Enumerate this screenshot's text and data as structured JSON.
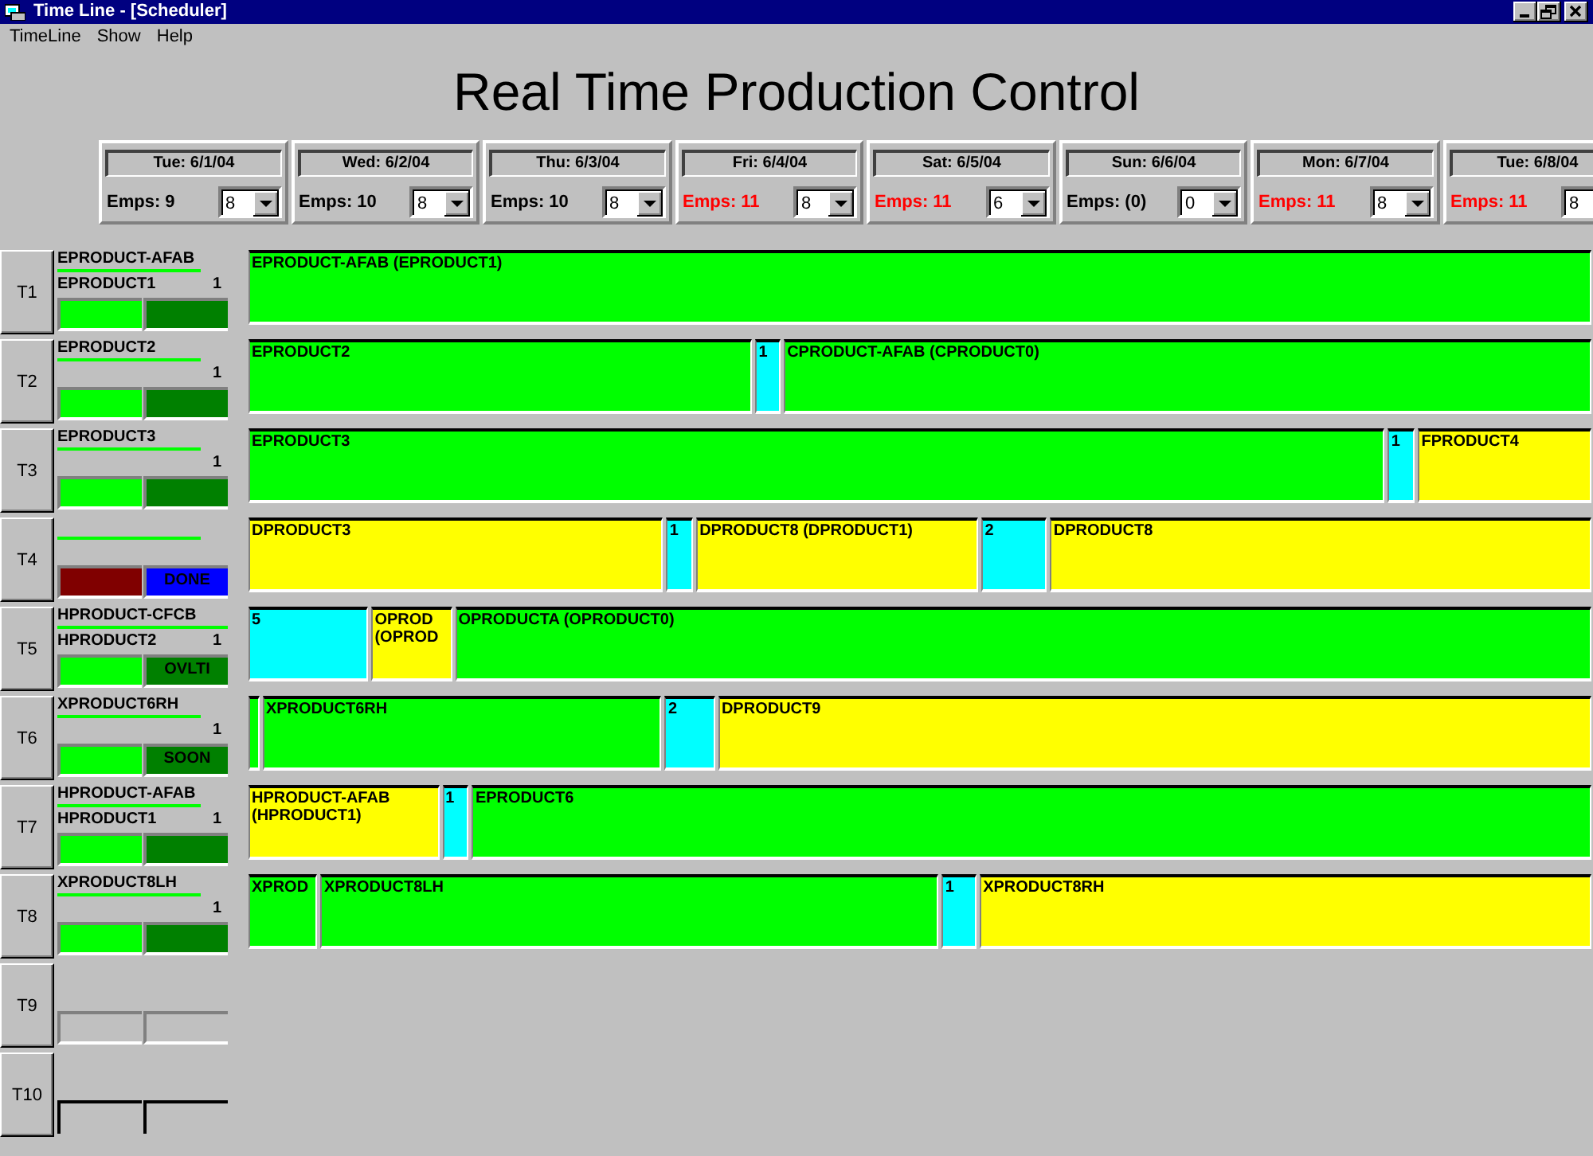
{
  "window": {
    "title": "Time Line - [Scheduler]",
    "controls": [
      {
        "kind": "minimize"
      },
      {
        "kind": "restore"
      },
      {
        "kind": "close"
      }
    ]
  },
  "menu": [
    {
      "label": "TimeLine"
    },
    {
      "label": "Show"
    },
    {
      "label": "Help"
    }
  ],
  "heading": "Real Time Production Control",
  "days": [
    {
      "date": "Tue: 6/1/04",
      "emps": "Emps: 9",
      "over": false,
      "shift": "8"
    },
    {
      "date": "Wed: 6/2/04",
      "emps": "Emps: 10",
      "over": false,
      "shift": "8"
    },
    {
      "date": "Thu: 6/3/04",
      "emps": "Emps: 10",
      "over": false,
      "shift": "8"
    },
    {
      "date": "Fri: 6/4/04",
      "emps": "Emps: 11",
      "over": true,
      "shift": "8"
    },
    {
      "date": "Sat: 6/5/04",
      "emps": "Emps: 11",
      "over": true,
      "shift": "6"
    },
    {
      "date": "Sun: 6/6/04",
      "emps": "Emps: (0)",
      "over": false,
      "shift": "0"
    },
    {
      "date": "Mon: 6/7/04",
      "emps": "Emps: 11",
      "over": true,
      "shift": "8"
    },
    {
      "date": "Tue: 6/8/04",
      "emps": "Emps: 11",
      "over": true,
      "shift": "8"
    }
  ],
  "lines": [
    {
      "button": "T1",
      "product": "EPRODUCT-AFAB",
      "sub_product": "EPRODUCT1",
      "count": "1",
      "progress": {
        "level": 0.84
      },
      "status": [
        {
          "kind": "filled",
          "color": "#00ff00"
        },
        {
          "kind": "filled",
          "color": "#008000"
        }
      ],
      "segments": [
        {
          "label": "EPRODUCT-AFAB (EPRODUCT1)",
          "color": "#00ff00"
        }
      ]
    },
    {
      "button": "T2",
      "product": "EPRODUCT2",
      "count": "1",
      "progress": {
        "level": 0.84
      },
      "status": [
        {
          "kind": "filled",
          "color": "#00ff00"
        },
        {
          "kind": "filled",
          "color": "#008000"
        }
      ],
      "segments": [
        {
          "label": "EPRODUCT2",
          "color": "#00ff00"
        },
        {
          "label": "1",
          "color": "#00ffff"
        },
        {
          "label": "CPRODUCT-AFAB (CPRODUCT0)",
          "color": "#00ff00"
        }
      ]
    },
    {
      "button": "T3",
      "product": "EPRODUCT3",
      "count": "1",
      "progress": {
        "level": 0.84
      },
      "status": [
        {
          "kind": "filled",
          "color": "#00ff00"
        },
        {
          "kind": "filled",
          "color": "#008000"
        }
      ],
      "segments": [
        {
          "label": "EPRODUCT3",
          "color": "#00ff00"
        },
        {
          "label": "1",
          "color": "#00ffff"
        },
        {
          "label": "FPRODUCT4",
          "color": "#ffff00"
        }
      ]
    },
    {
      "button": "T4",
      "progress": {
        "level": 0.84
      },
      "status": [
        {
          "kind": "filled",
          "color": "#800000"
        },
        {
          "kind": "filled",
          "color": "#0000ff",
          "label": "DONE"
        }
      ],
      "segments": [
        {
          "label": "DPRODUCT3",
          "color": "#ffff00"
        },
        {
          "label": "1",
          "color": "#00ffff"
        },
        {
          "label": "DPRODUCT8 (DPRODUCT1)",
          "color": "#ffff00"
        },
        {
          "label": "2",
          "color": "#00ffff"
        },
        {
          "label": "DPRODUCT8",
          "color": "#ffff00"
        }
      ]
    },
    {
      "button": "T5",
      "product": "HPRODUCT-CFCB",
      "sub_product": "HPRODUCT2",
      "count": "1",
      "progress": {
        "level": 1
      },
      "status": [
        {
          "kind": "filled",
          "color": "#00ff00"
        },
        {
          "kind": "filled",
          "color": "#008000",
          "label": "OVLTI"
        }
      ],
      "segments": [
        {
          "label": "5",
          "color": "#00ffff"
        },
        {
          "label": "OPROD (OPROD",
          "color": "#ffff00"
        },
        {
          "label": "OPRODUCTA (OPRODUCT0)",
          "color": "#00ff00"
        }
      ]
    },
    {
      "button": "T6",
      "product": "XPRODUCT6RH",
      "count": "1",
      "progress": {
        "level": 0.84
      },
      "status": [
        {
          "kind": "filled",
          "color": "#00ff00"
        },
        {
          "kind": "filled",
          "color": "#008000",
          "label": "SOON"
        }
      ],
      "segments": [
        {
          "color": "#00ff00"
        },
        {
          "label": "XPRODUCT6RH",
          "color": "#00ff00"
        },
        {
          "label": "2",
          "color": "#00ffff"
        },
        {
          "label": "DPRODUCT9",
          "color": "#ffff00"
        }
      ]
    },
    {
      "button": "T7",
      "product": "HPRODUCT-AFAB",
      "sub_product": "HPRODUCT1",
      "count": "1",
      "progress": {
        "level": 0.84
      },
      "status": [
        {
          "kind": "filled",
          "color": "#00ff00"
        },
        {
          "kind": "filled",
          "color": "#008000"
        }
      ],
      "segments": [
        {
          "label": "HPRODUCT-AFAB (HPRODUCT1)",
          "color": "#ffff00"
        },
        {
          "label": "1",
          "color": "#00ffff"
        },
        {
          "label": "EPRODUCT6",
          "color": "#00ff00"
        }
      ]
    },
    {
      "button": "T8",
      "product": "XPRODUCT8LH",
      "count": "1",
      "progress": {
        "level": 0.84
      },
      "status": [
        {
          "kind": "filled",
          "color": "#00ff00"
        },
        {
          "kind": "filled",
          "color": "#008000"
        }
      ],
      "segments": [
        {
          "label": "XPROD",
          "color": "#00ff00"
        },
        {
          "label": "XPRODUCT8LH",
          "color": "#00ff00"
        },
        {
          "label": "1",
          "color": "#00ffff"
        },
        {
          "label": "XPRODUCT8RH",
          "color": "#ffff00"
        }
      ]
    },
    {
      "button": "T9",
      "status": [
        {
          "kind": "empty"
        },
        {
          "kind": "empty"
        }
      ]
    },
    {
      "button": "T10",
      "status": [
        {
          "kind": "dark"
        },
        {
          "kind": "dark"
        }
      ]
    }
  ]
}
